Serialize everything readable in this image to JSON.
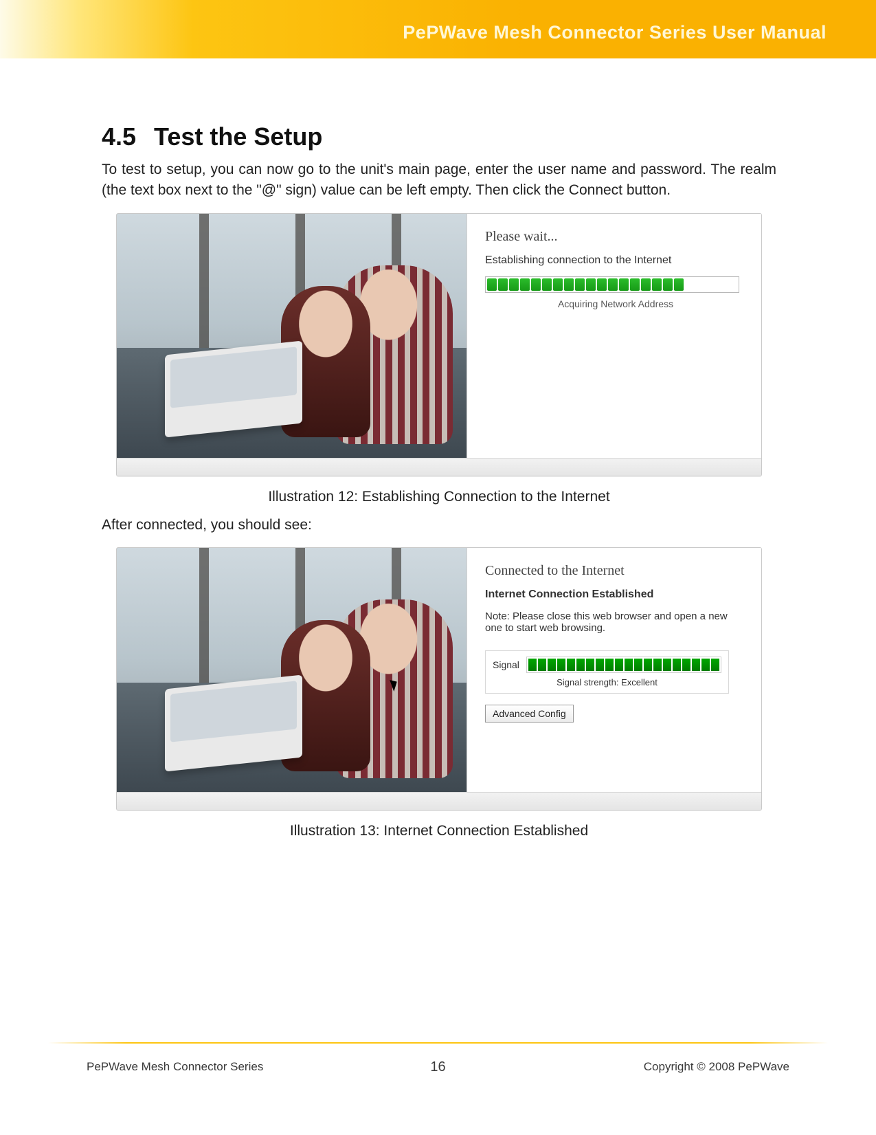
{
  "header": {
    "title": "PePWave Mesh Connector Series User Manual"
  },
  "section": {
    "number": "4.5",
    "title": "Test the Setup"
  },
  "body": {
    "p1": "To test to setup, you can now go to the unit's main page, enter the user name and password.  The realm (the text box next to the \"@\" sign) value can be left empty.  Then click the Connect button.",
    "caption1": "Illustration 12: Establishing Connection to the Internet",
    "after": "After connected, you should see:",
    "caption2": "Illustration 13: Internet Connection Established"
  },
  "shot1": {
    "please_wait": "Please wait...",
    "establishing": "Establishing connection to the Internet",
    "status": "Acquiring Network Address",
    "progress_segments": 18
  },
  "shot2": {
    "connected": "Connected to the Internet",
    "established": "Internet Connection Established",
    "note": "Note: Please close this web browser and open a new one to start web browsing.",
    "signal_label": "Signal",
    "signal_segments": 20,
    "signal_strength": "Signal strength: Excellent",
    "advanced": "Advanced Config"
  },
  "footer": {
    "left": "PePWave  Mesh Connector Series",
    "page": "16",
    "right": "Copyright © 2008 PePWave"
  }
}
